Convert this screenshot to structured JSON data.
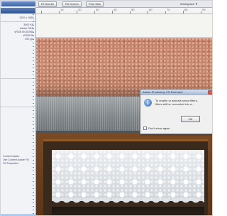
{
  "toolbar": {
    "buttons": [
      "Fit Screen",
      "Fill Screen",
      "Print Size"
    ],
    "workspace_label": "Workspace ▼"
  },
  "panel": {
    "rows": [
      {
        "label": "",
        "value": "1920 x 1080"
      },
      {
        "label": "",
        "value": "3000 KB"
      },
      {
        "label": "",
        "value": "Adobe RGB"
      },
      {
        "label": "",
        "value": "sRGB IEC61966"
      },
      {
        "label": "",
        "value": "sRGB 96"
      },
      {
        "label": "",
        "value": "300 ppi"
      },
      {
        "label": "Content Aware",
        "value": ""
      },
      {
        "label": "Use Content Aware Fill",
        "value": ""
      },
      {
        "label": "Fill Properties",
        "value": ""
      }
    ]
  },
  "ruler": {
    "ticks": [
      "",
      "10",
      "20",
      "30",
      "40",
      "50",
      "60",
      "70",
      "80",
      "90"
    ]
  },
  "dialog": {
    "title": "Adobe Photoshop CS Extended",
    "line1": "To enable or activate smart filters,",
    "line2": "filters will be converted into a...",
    "ok_label": "OK",
    "checkbox_label": "Don't show again"
  },
  "colors": {
    "accent": "#3f65a8",
    "wall": "#c7826a",
    "frame": "#6b3e1d"
  },
  "icons": {
    "dialog": "info-icon",
    "close": "close-icon"
  }
}
